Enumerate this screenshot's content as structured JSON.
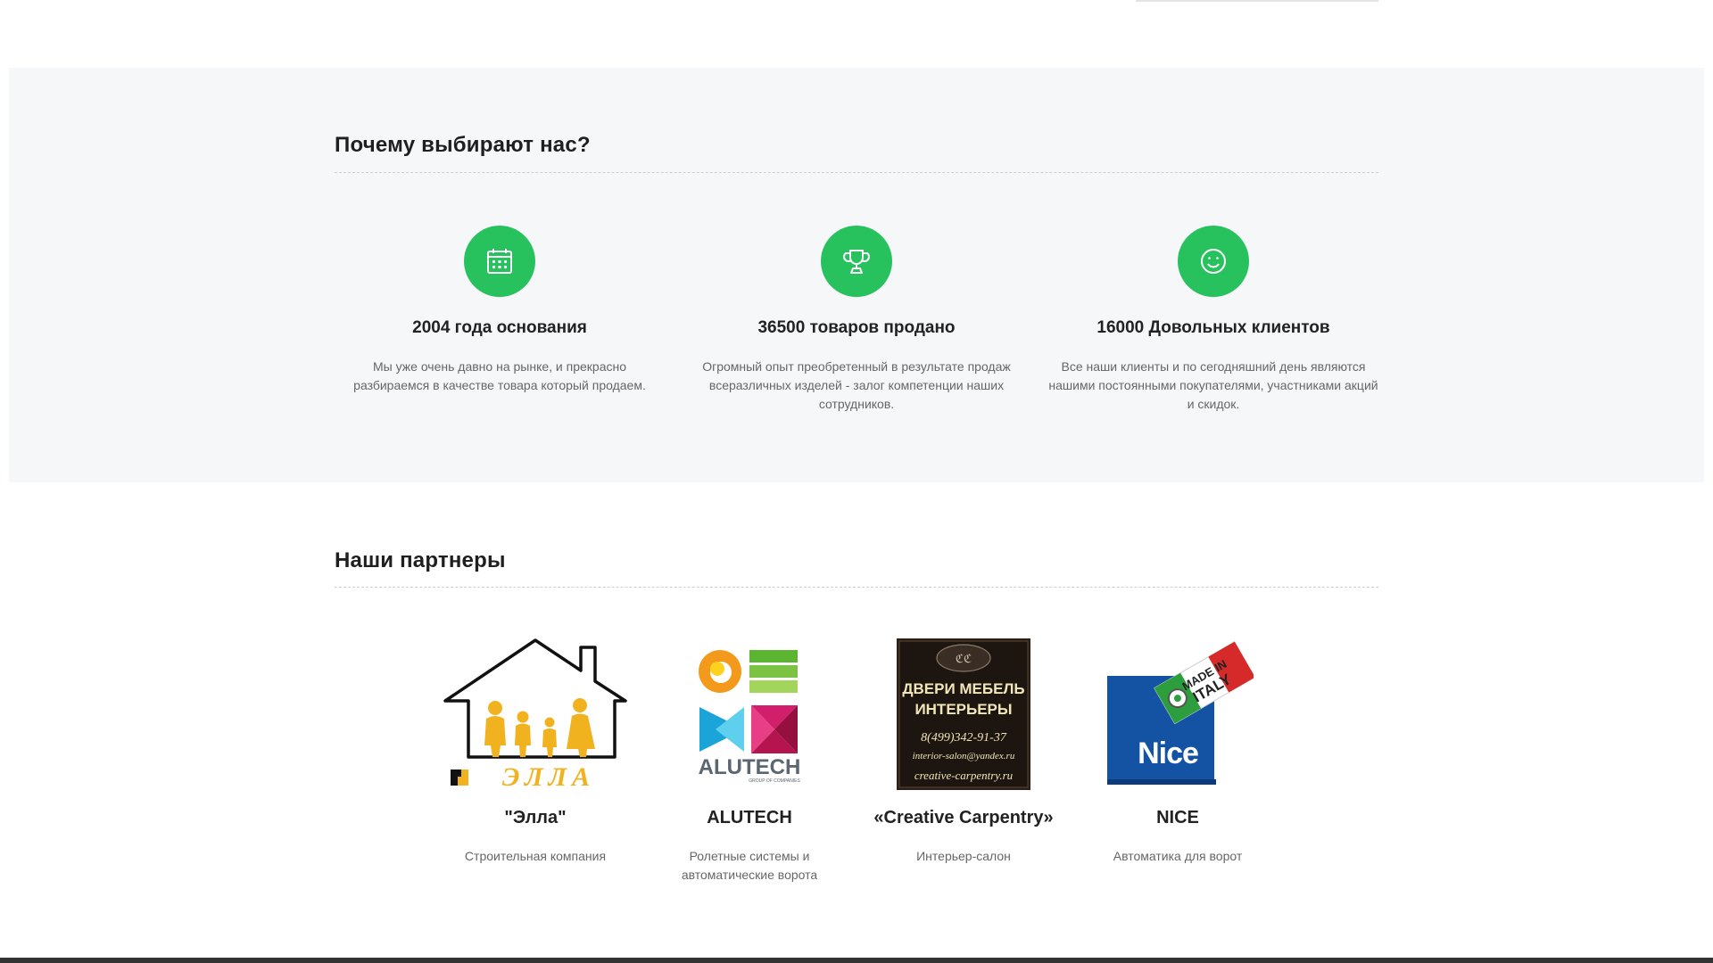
{
  "why": {
    "title": "Почему выбирают нас?",
    "features": [
      {
        "icon": "calendar-icon",
        "title": "2004 года основания",
        "text": "Мы уже очень давно на рынке, и прекрасно разбираемся в качестве товара который продаем."
      },
      {
        "icon": "trophy-icon",
        "title": "36500 товаров продано",
        "text": "Огромный опыт преобретенный в результате продаж всеразличных изделей - залог компетенции наших сотрудников."
      },
      {
        "icon": "smile-icon",
        "title": "16000 Довольных клиентов",
        "text": "Все наши клиенты и по сегодняшний день являются нашими постоянными покупателями, участниками акций и скидок."
      }
    ]
  },
  "partners": {
    "title": "Наши партнеры",
    "items": [
      {
        "name": "\"Элла\"",
        "desc": "Строительная компания",
        "logo_text": "ЭЛЛА"
      },
      {
        "name": "ALUTECH",
        "desc": "Ролетные системы и автоматические ворота",
        "logo_text": "ALUTECH",
        "logo_sub": "GROUP OF COMPANIES"
      },
      {
        "name": "«Creative Carpentry»",
        "desc": "Интерьер-салон",
        "logo_lines": [
          "ДВЕРИ МЕБЕЛЬ",
          "ИНТЕРЬЕРЫ",
          "8(499)342-91-37",
          "interior-salon@yandex.ru",
          "creative-carpentry.ru"
        ]
      },
      {
        "name": "NICE",
        "desc": "Автоматика для ворот",
        "logo_text": "Nice",
        "badge_lines": [
          "MADE IN",
          "ITALY"
        ]
      }
    ]
  },
  "colors": {
    "accent": "#27c25e",
    "section_bg": "#f6f7f9"
  }
}
